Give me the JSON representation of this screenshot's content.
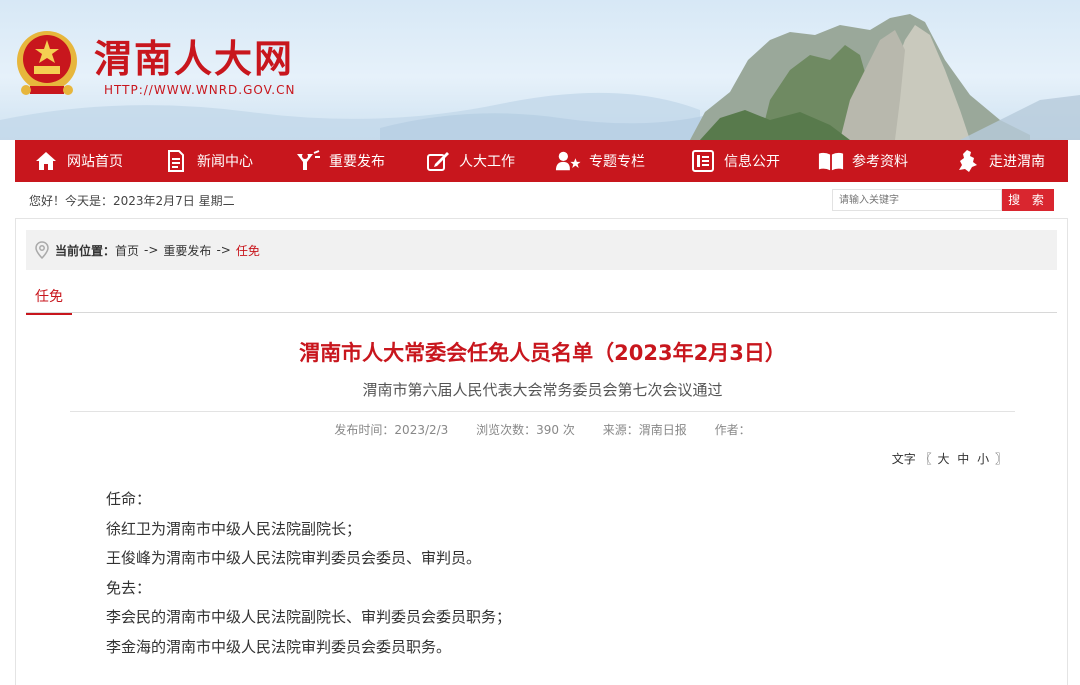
{
  "header": {
    "site_title": "渭南人大网",
    "site_url": "HTTP://WWW.WNRD.GOV.CN"
  },
  "nav": [
    {
      "label": "网站首页",
      "icon": "home-icon"
    },
    {
      "label": "新闻中心",
      "icon": "document-icon"
    },
    {
      "label": "重要发布",
      "icon": "megaphone-icon"
    },
    {
      "label": "人大工作",
      "icon": "edit-icon"
    },
    {
      "label": "专题专栏",
      "icon": "user-star-icon"
    },
    {
      "label": "信息公开",
      "icon": "list-icon"
    },
    {
      "label": "参考资料",
      "icon": "book-icon"
    },
    {
      "label": "走进渭南",
      "icon": "map-icon"
    }
  ],
  "infobar": {
    "greeting": "您好！今天是：2023年2月7日 星期二",
    "search_placeholder": "请输入关键字",
    "search_button": "搜 索"
  },
  "breadcrumb": {
    "label": "当前位置：",
    "items": [
      "首页",
      "重要发布"
    ],
    "separator": "->",
    "current": "任免"
  },
  "tab": {
    "label": "任免"
  },
  "article": {
    "title": "渭南市人大常委会任免人员名单（2023年2月3日）",
    "subtitle": "渭南市第六届人民代表大会常务委员会第七次会议通过",
    "meta": {
      "published": "发布时间：2023/2/3",
      "views": "浏览次数：390 次",
      "source": "来源：渭南日报",
      "author": "作者："
    },
    "font_size": {
      "prefix": "文字 〖",
      "large": "大",
      "medium": "中",
      "small": "小",
      "suffix": "〗"
    },
    "paragraphs": [
      "任命：",
      "徐红卫为渭南市中级人民法院副院长；",
      "王俊峰为渭南市中级人民法院审判委员会委员、审判员。",
      "免去：",
      "李会民的渭南市中级人民法院副院长、审判委员会委员职务；",
      "李金海的渭南市中级人民法院审判委员会委员职务。"
    ]
  },
  "colors": {
    "brand_red": "#c8161d",
    "button_red": "#d9262f"
  }
}
